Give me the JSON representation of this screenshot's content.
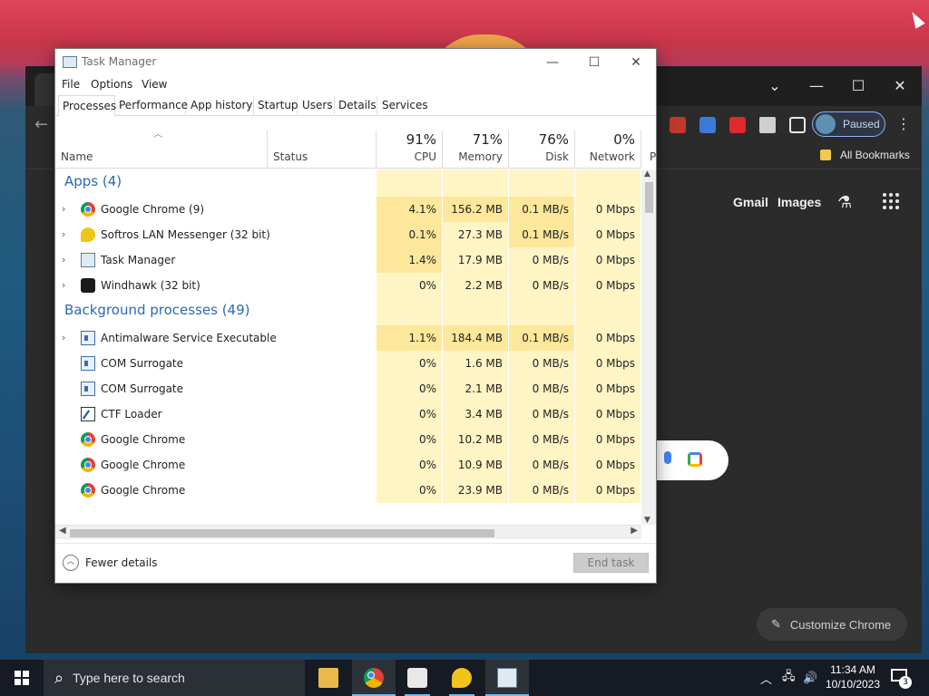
{
  "task_manager": {
    "title": "Task Manager",
    "menu": [
      "File",
      "Options",
      "View"
    ],
    "tabs": [
      "Processes",
      "Performance",
      "App history",
      "Startup",
      "Users",
      "Details",
      "Services"
    ],
    "active_tab": "Processes",
    "columns": {
      "name": "Name",
      "status": "Status",
      "cpu": {
        "pct": "91%",
        "label": "CPU"
      },
      "memory": {
        "pct": "71%",
        "label": "Memory"
      },
      "disk": {
        "pct": "76%",
        "label": "Disk"
      },
      "network": {
        "pct": "0%",
        "label": "Network"
      },
      "more": "P"
    },
    "groups": {
      "apps": "Apps (4)",
      "background": "Background processes (49)"
    },
    "apps": [
      {
        "name": "Google Chrome (9)",
        "icon": "chrome-icon",
        "cpu": "4.1%",
        "memory": "156.2 MB",
        "disk": "0.1 MB/s",
        "network": "0 Mbps"
      },
      {
        "name": "Softros LAN Messenger (32 bit)",
        "icon": "softros-icon",
        "cpu": "0.1%",
        "memory": "27.3 MB",
        "disk": "0.1 MB/s",
        "network": "0 Mbps"
      },
      {
        "name": "Task Manager",
        "icon": "task-manager-icon",
        "cpu": "1.4%",
        "memory": "17.9 MB",
        "disk": "0 MB/s",
        "network": "0 Mbps"
      },
      {
        "name": "Windhawk (32 bit)",
        "icon": "windhawk-icon",
        "cpu": "0%",
        "memory": "2.2 MB",
        "disk": "0 MB/s",
        "network": "0 Mbps"
      }
    ],
    "background": [
      {
        "name": "Antimalware Service Executable",
        "icon": "service-icon",
        "cpu": "1.1%",
        "memory": "184.4 MB",
        "disk": "0.1 MB/s",
        "network": "0 Mbps"
      },
      {
        "name": "COM Surrogate",
        "icon": "service-icon",
        "cpu": "0%",
        "memory": "1.6 MB",
        "disk": "0 MB/s",
        "network": "0 Mbps"
      },
      {
        "name": "COM Surrogate",
        "icon": "service-icon",
        "cpu": "0%",
        "memory": "2.1 MB",
        "disk": "0 MB/s",
        "network": "0 Mbps"
      },
      {
        "name": "CTF Loader",
        "icon": "ctf-icon",
        "cpu": "0%",
        "memory": "3.4 MB",
        "disk": "0 MB/s",
        "network": "0 Mbps"
      },
      {
        "name": "Google Chrome",
        "icon": "chrome-icon",
        "cpu": "0%",
        "memory": "10.2 MB",
        "disk": "0 MB/s",
        "network": "0 Mbps"
      },
      {
        "name": "Google Chrome",
        "icon": "chrome-icon",
        "cpu": "0%",
        "memory": "10.9 MB",
        "disk": "0 MB/s",
        "network": "0 Mbps"
      },
      {
        "name": "Google Chrome",
        "icon": "chrome-icon",
        "cpu": "0%",
        "memory": "23.9 MB",
        "disk": "0 MB/s",
        "network": "0 Mbps"
      }
    ],
    "footer": {
      "fewer_details": "Fewer details",
      "end_task": "End task"
    }
  },
  "chrome": {
    "profile_status": "Paused",
    "bookmarks_label": "All Bookmarks",
    "links": {
      "gmail": "Gmail",
      "images": "Images"
    },
    "customize_label": "Customize Chrome"
  },
  "taskbar": {
    "search_placeholder": "Type here to search",
    "time": "11:34 AM",
    "date": "10/10/2023",
    "notification_count": "3"
  },
  "colors": {
    "cpu_heat_high": "#fde79a",
    "cpu_heat_low": "#fff4c4",
    "group_title": "#2a6ab3",
    "chrome_bg": "#2b2b2b",
    "taskbar_bg": "#161a22"
  }
}
